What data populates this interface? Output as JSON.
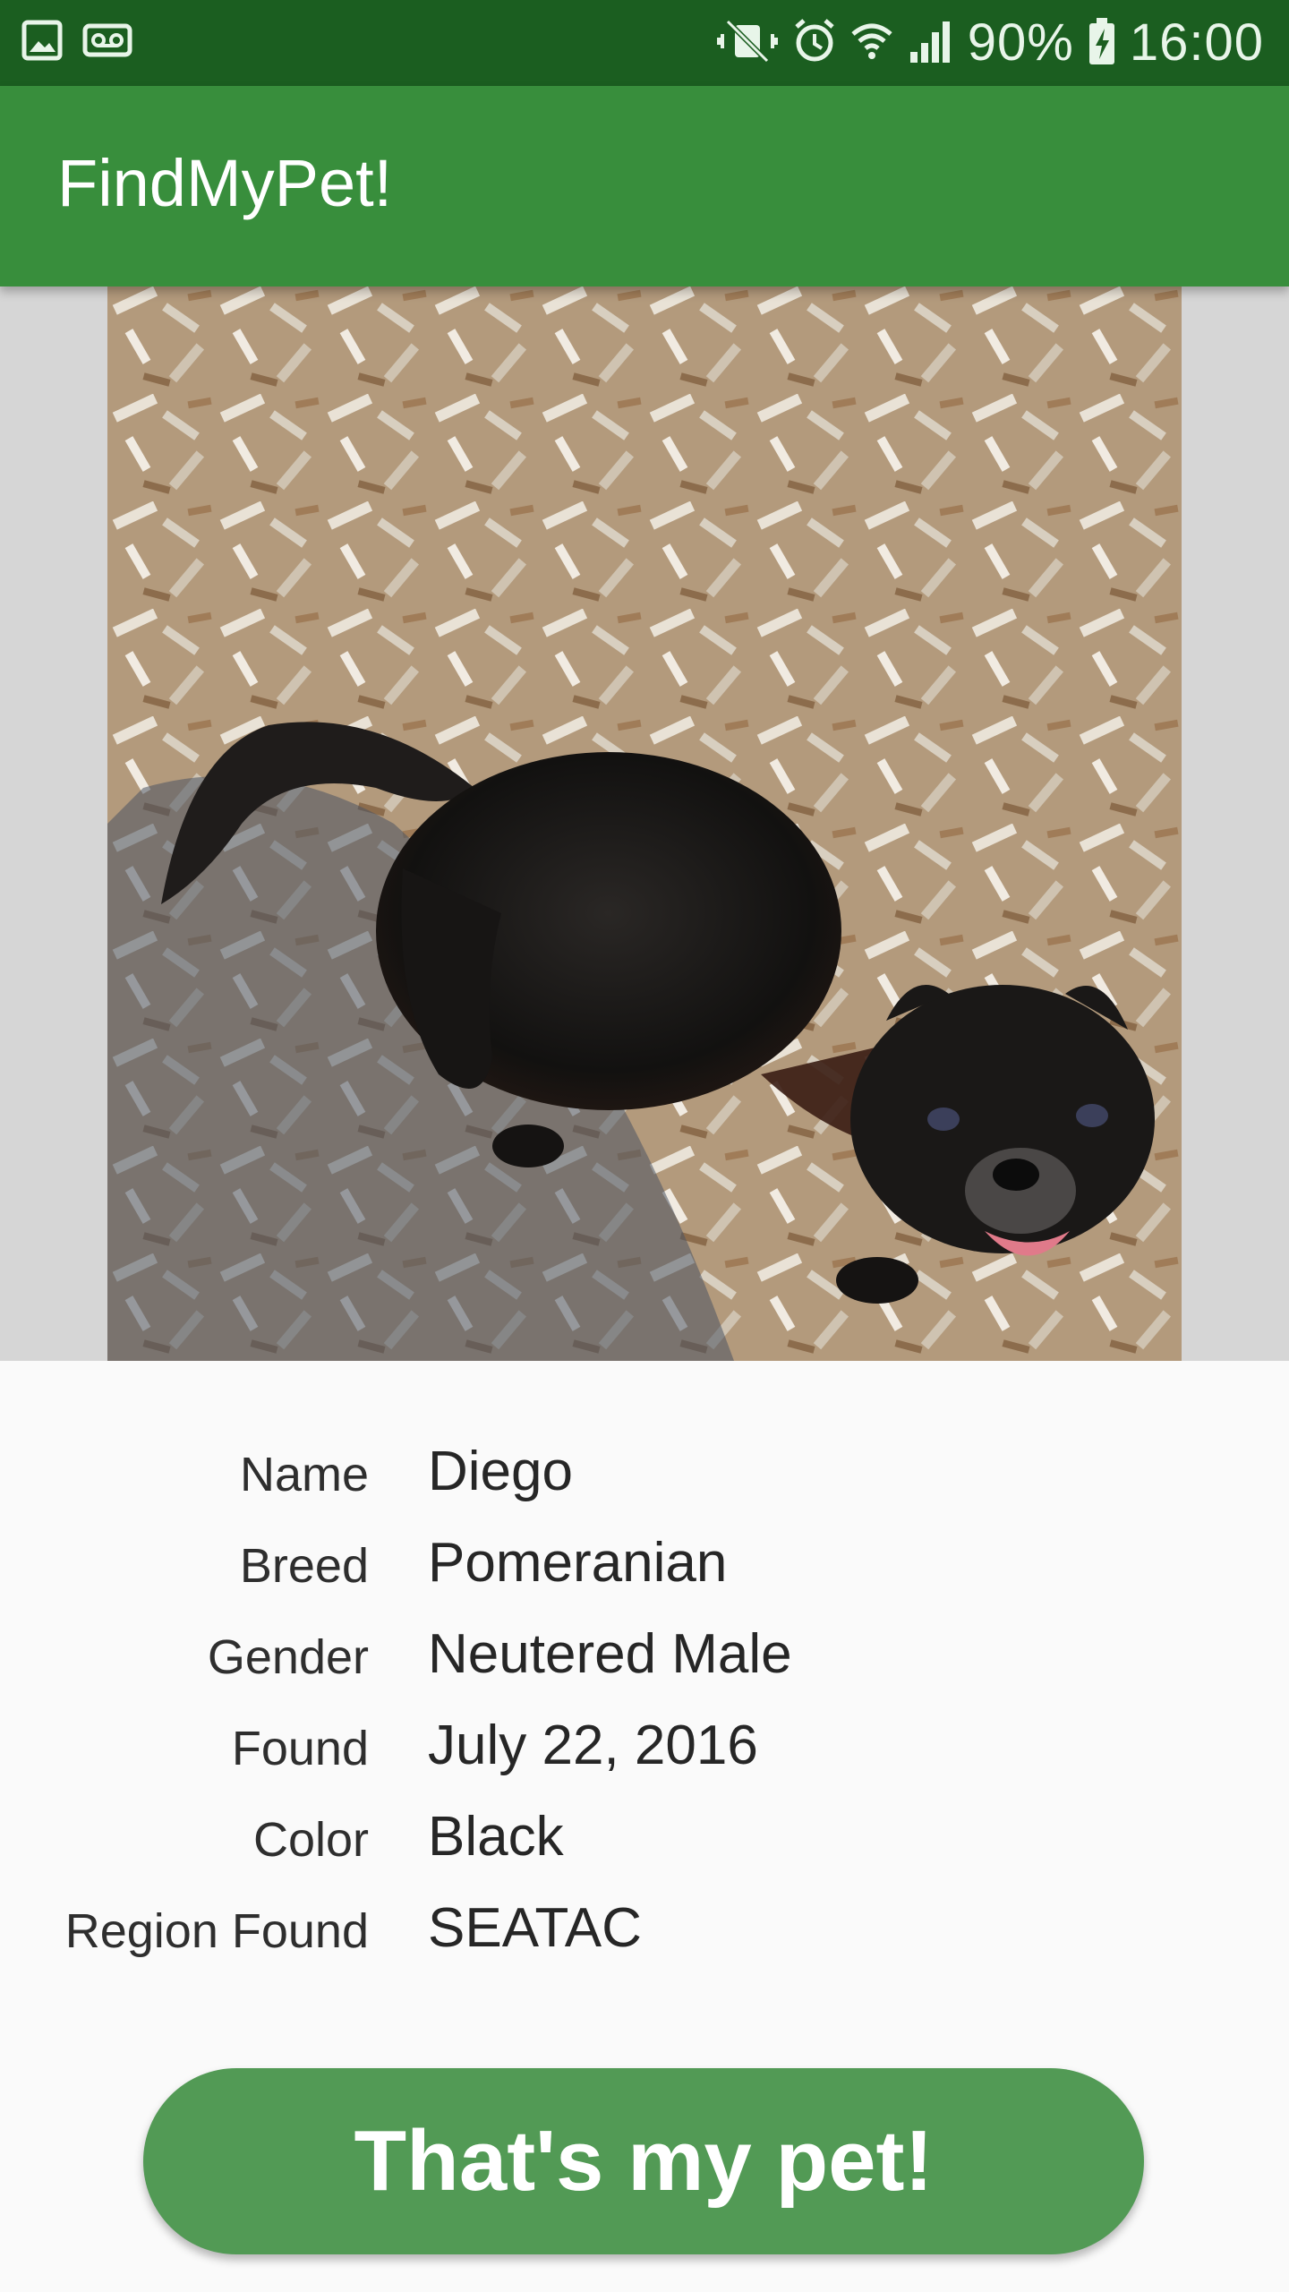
{
  "status_bar": {
    "battery": "90%",
    "time": "16:00",
    "left_icons": [
      "image-icon",
      "voicemail-icon"
    ],
    "right_icons": [
      "mute-icon",
      "alarm-icon",
      "wifi-icon",
      "signal-icon",
      "battery-charging-icon"
    ]
  },
  "app_bar": {
    "title": "FindMyPet!"
  },
  "pet": {
    "photo_subject": "black-dog-photo",
    "fields": [
      {
        "label": "Name",
        "value": "Diego"
      },
      {
        "label": "Breed",
        "value": "Pomeranian"
      },
      {
        "label": "Gender",
        "value": "Neutered Male"
      },
      {
        "label": "Found",
        "value": "July 22, 2016"
      },
      {
        "label": "Color",
        "value": "Black"
      },
      {
        "label": "Region Found",
        "value": "SEATAC"
      }
    ]
  },
  "actions": {
    "claim_label": "That's my pet!"
  },
  "colors": {
    "status_bar": "#1b5e20",
    "app_bar": "#388e3c",
    "button": "#529a55",
    "photo_background": "#d6d6d6"
  }
}
